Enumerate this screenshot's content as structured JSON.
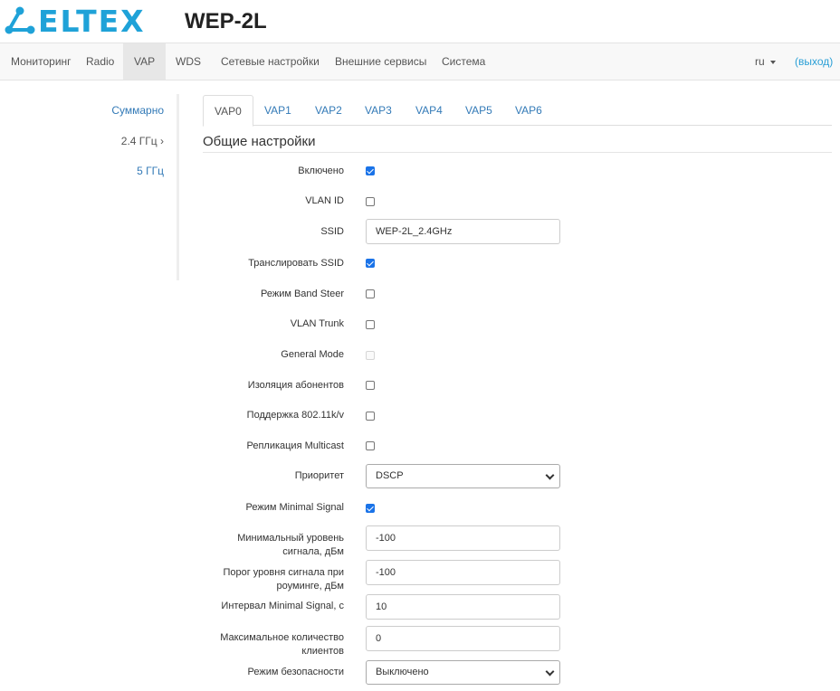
{
  "brand": {
    "logo_text": "ELTEX",
    "model": "WEP-2L",
    "logo_color": "#1fa2d8"
  },
  "nav": {
    "items": [
      "Мониторинг",
      "Radio",
      "VAP",
      "WDS",
      "Сетевые настройки",
      "Внешние сервисы",
      "Система"
    ],
    "active": "VAP",
    "lang": "ru",
    "exit": "(выход)"
  },
  "sidebar": {
    "items": [
      "Суммарно",
      "2.4 ГГц ›",
      "5 ГГц"
    ]
  },
  "tabs": {
    "items": [
      "VAP0",
      "VAP1",
      "VAP2",
      "VAP3",
      "VAP4",
      "VAP5",
      "VAP6"
    ],
    "active": "VAP0"
  },
  "section": {
    "title": "Общие настройки"
  },
  "form": {
    "enabled": {
      "label": "Включено",
      "checked": true
    },
    "vlan_id": {
      "label": "VLAN ID",
      "checked": false
    },
    "ssid": {
      "label": "SSID",
      "value": "WEP-2L_2.4GHz"
    },
    "broadcast_ssid": {
      "label": "Транслировать SSID",
      "checked": true
    },
    "band_steer": {
      "label": "Режим Band Steer",
      "checked": false
    },
    "vlan_trunk": {
      "label": "VLAN Trunk",
      "checked": false
    },
    "general_mode": {
      "label": "General Mode",
      "checked": false,
      "disabled": true
    },
    "isolation": {
      "label": "Изоляция абонентов",
      "checked": false
    },
    "kv_support": {
      "label": "Поддержка 802.11k/v",
      "checked": false
    },
    "multicast": {
      "label": "Репликация Multicast",
      "checked": false
    },
    "priority": {
      "label": "Приоритет",
      "value": "DSCP"
    },
    "minimal_signal": {
      "label": "Режим Minimal Signal",
      "checked": true
    },
    "min_level": {
      "label_line1": "Минимальный уровень",
      "label_line2": "сигнала, дБм",
      "value": "-100"
    },
    "roaming_threshold": {
      "label_line1": "Порог уровня сигнала при",
      "label_line2": "роуминге, дБм",
      "value": "-100"
    },
    "min_signal_interval": {
      "label": "Интервал Minimal Signal, с",
      "value": "10"
    },
    "max_clients": {
      "label_line1": "Максимальное количество",
      "label_line2": "клиентов",
      "value": "0"
    },
    "security": {
      "label": "Режим безопасности",
      "value": "Выключено"
    }
  }
}
